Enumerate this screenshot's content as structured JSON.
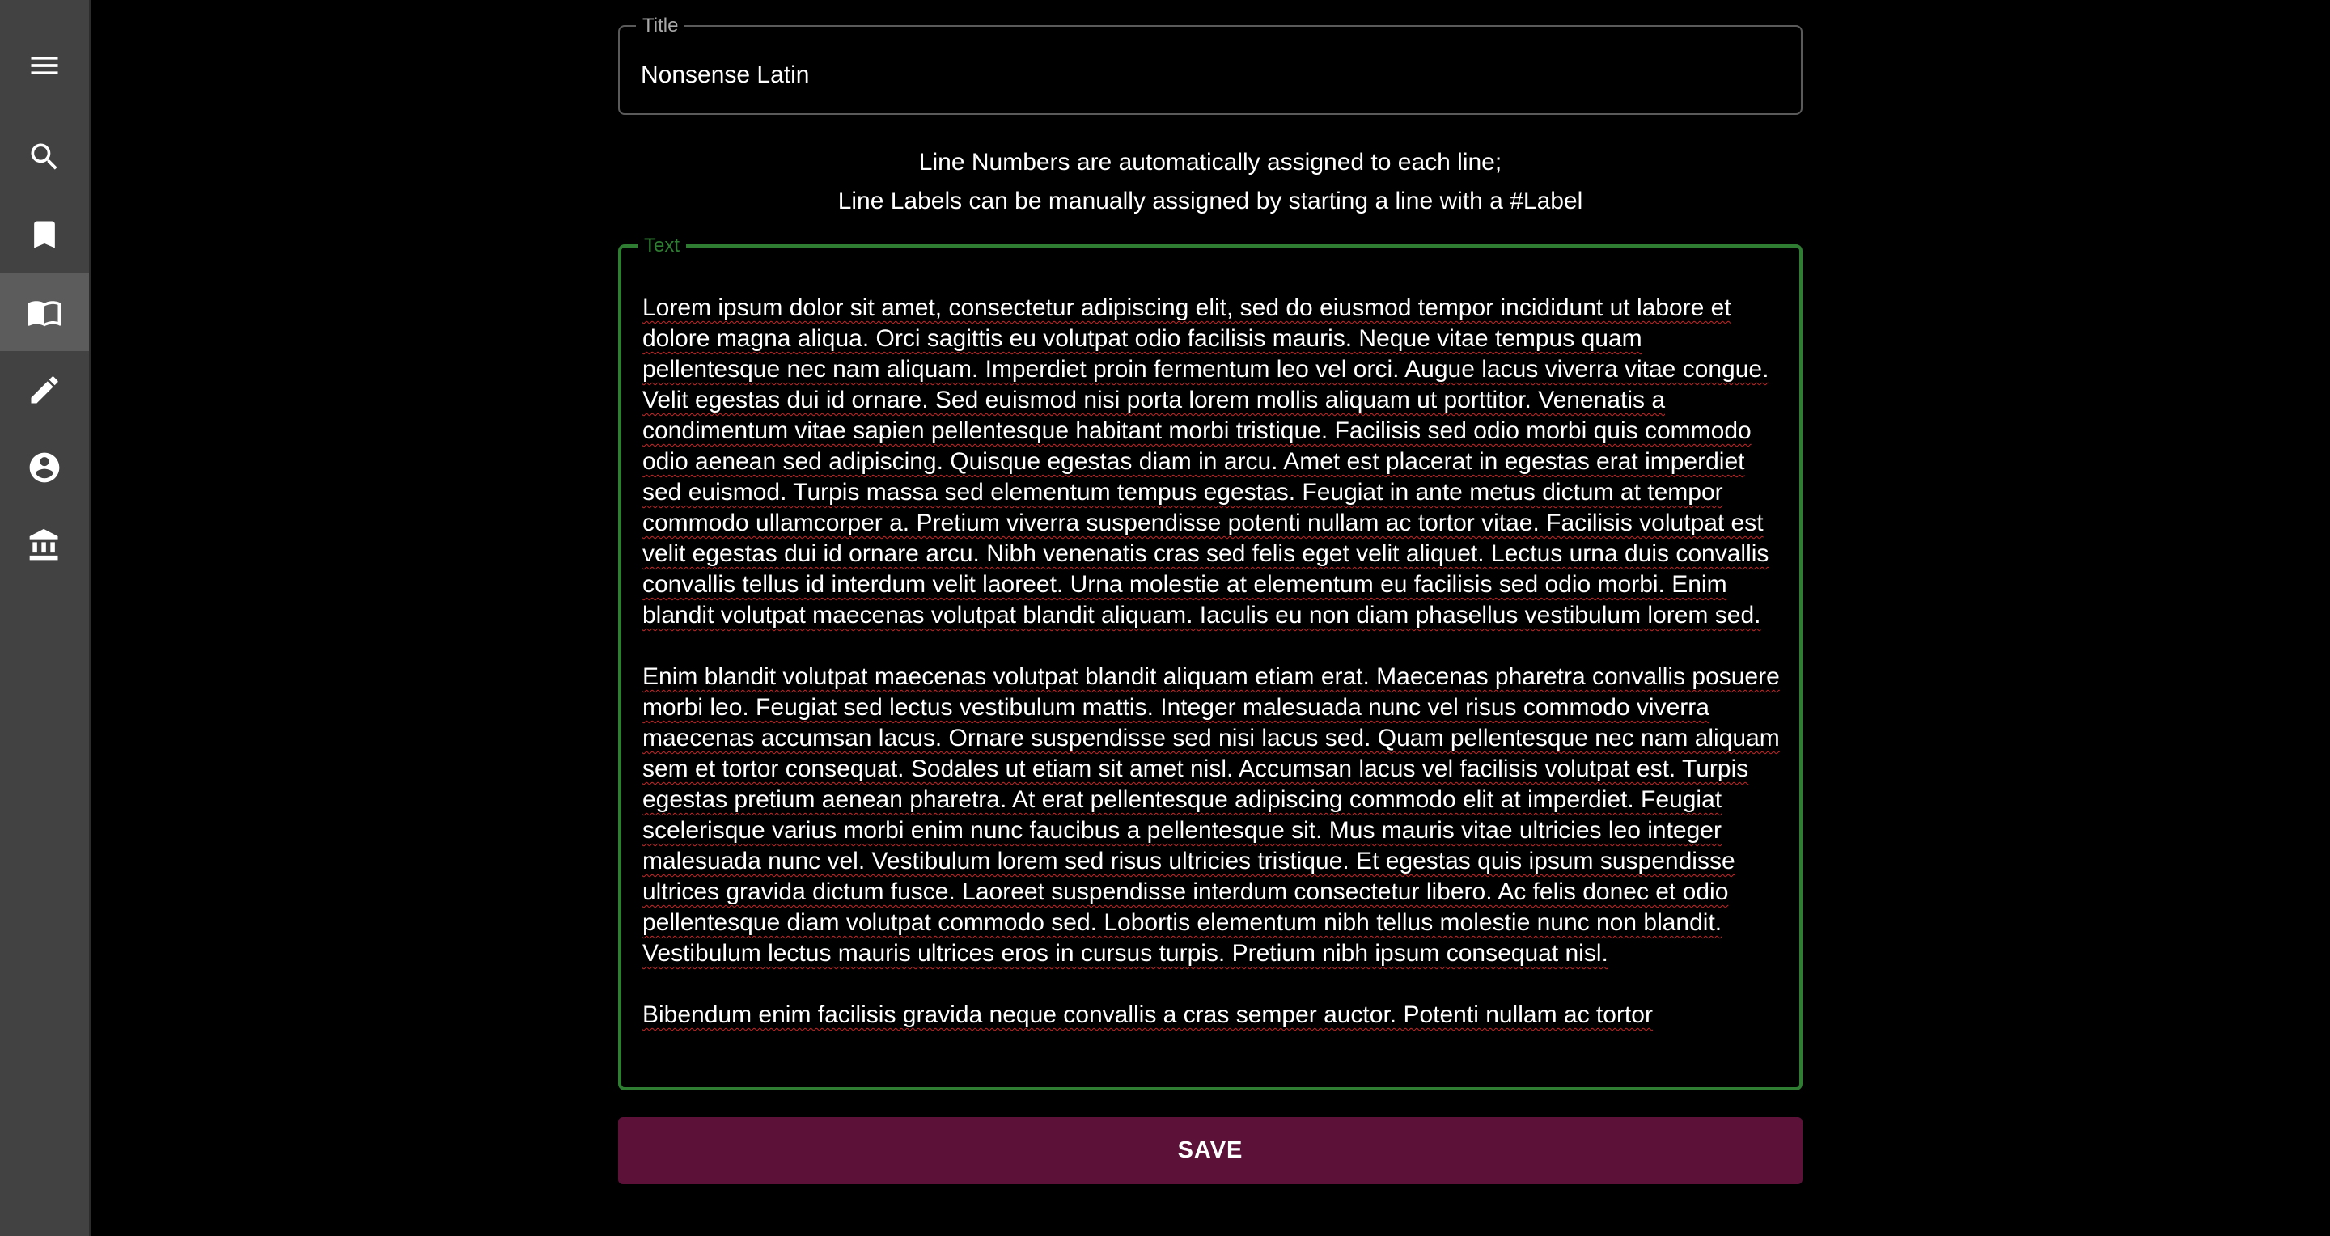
{
  "sidebar": {
    "items": [
      {
        "name": "menu-icon"
      },
      {
        "name": "search-icon"
      },
      {
        "name": "bookmark-icon"
      },
      {
        "name": "book-icon",
        "active": true
      },
      {
        "name": "pencil-icon"
      },
      {
        "name": "account-icon"
      },
      {
        "name": "institution-icon"
      }
    ]
  },
  "form": {
    "title_label": "Title",
    "title_value": "Nonsense Latin",
    "hint_line1": "Line Numbers are automatically assigned to each line;",
    "hint_line2": "Line Labels can be manually assigned by starting a line with a #Label",
    "text_label": "Text",
    "paragraphs": [
      "Lorem ipsum dolor sit amet, consectetur adipiscing elit, sed do eiusmod tempor incididunt ut labore et dolore magna aliqua. Orci sagittis eu volutpat odio facilisis mauris. Neque vitae tempus quam pellentesque nec nam aliquam. Imperdiet proin fermentum leo vel orci. Augue lacus viverra vitae congue. Velit egestas dui id ornare. Sed euismod nisi porta lorem mollis aliquam ut porttitor. Venenatis a condimentum vitae sapien pellentesque habitant morbi tristique. Facilisis sed odio morbi quis commodo odio aenean sed adipiscing. Quisque egestas diam in arcu. Amet est placerat in egestas erat imperdiet sed euismod. Turpis massa sed elementum tempus egestas. Feugiat in ante metus dictum at tempor commodo ullamcorper a. Pretium viverra suspendisse potenti nullam ac tortor vitae. Facilisis volutpat est velit egestas dui id ornare arcu. Nibh venenatis cras sed felis eget velit aliquet. Lectus urna duis convallis convallis tellus id interdum velit laoreet. Urna molestie at elementum eu facilisis sed odio morbi. Enim blandit volutpat maecenas volutpat blandit aliquam. Iaculis eu non diam phasellus vestibulum lorem sed.",
      "Enim blandit volutpat maecenas volutpat blandit aliquam etiam erat. Maecenas pharetra convallis posuere morbi leo. Feugiat sed lectus vestibulum mattis. Integer malesuada nunc vel risus commodo viverra maecenas accumsan lacus. Ornare suspendisse sed nisi lacus sed. Quam pellentesque nec nam aliquam sem et tortor consequat. Sodales ut etiam sit amet nisl. Accumsan lacus vel facilisis volutpat est. Turpis egestas pretium aenean pharetra. At erat pellentesque adipiscing commodo elit at imperdiet. Feugiat scelerisque varius morbi enim nunc faucibus a pellentesque sit. Mus mauris vitae ultricies leo integer malesuada nunc vel. Vestibulum lorem sed risus ultricies tristique. Et egestas quis ipsum suspendisse ultrices gravida dictum fusce. Laoreet suspendisse interdum consectetur libero. Ac felis donec et odio pellentesque diam volutpat commodo sed. Lobortis elementum nibh tellus molestie nunc non blandit. Vestibulum lectus mauris ultrices eros in cursus turpis. Pretium nibh ipsum consequat nisl.",
      "Bibendum enim facilisis gravida neque convallis a cras semper auctor. Potenti nullam ac tortor"
    ],
    "save_label": "SAVE"
  },
  "colors": {
    "background": "#000000",
    "sidebar": "#424242",
    "sidebar_active": "#5c5c5c",
    "text_border": "#2e7d32",
    "save_button": "#5c1238"
  }
}
